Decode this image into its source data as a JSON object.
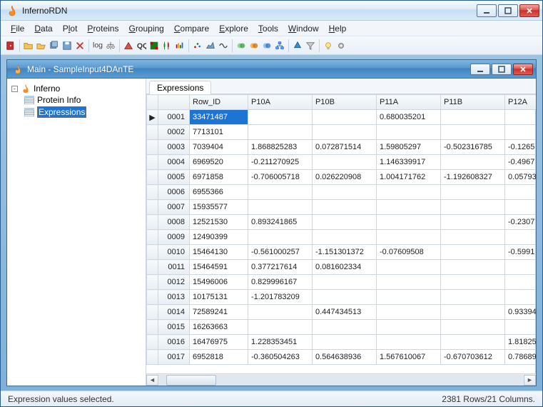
{
  "app_title": "InfernoRDN",
  "menu": [
    "File",
    "Data",
    "Plot",
    "Proteins",
    "Grouping",
    "Compare",
    "Explore",
    "Tools",
    "Window",
    "Help"
  ],
  "child_title": "Main - SampleInput4DAnTE",
  "tree": {
    "root": "Inferno",
    "children": [
      "Protein Info",
      "Expressions"
    ],
    "selected": 1
  },
  "tab_label": "Expressions",
  "columns": [
    "Row_ID",
    "P10A",
    "P10B",
    "P11A",
    "P11B",
    "P12A"
  ],
  "rows": [
    {
      "n": "0001",
      "marker": "▶",
      "cells": [
        "33471487",
        "",
        "",
        "0.680035201",
        "",
        ""
      ],
      "sel": 0
    },
    {
      "n": "0002",
      "cells": [
        "7713101",
        "",
        "",
        "",
        "",
        ""
      ]
    },
    {
      "n": "0003",
      "cells": [
        "7039404",
        "1.868825283",
        "0.072871514",
        "1.59805297",
        "-0.502316785",
        "-0.1265"
      ]
    },
    {
      "n": "0004",
      "cells": [
        "6969520",
        "-0.211270925",
        "",
        "1.146339917",
        "",
        "-0.4967"
      ]
    },
    {
      "n": "0005",
      "cells": [
        "6971858",
        "-0.706005718",
        "0.026220908",
        "1.004171762",
        "-1.192608327",
        "0.05793"
      ]
    },
    {
      "n": "0006",
      "cells": [
        "6955366",
        "",
        "",
        "",
        "",
        ""
      ]
    },
    {
      "n": "0007",
      "cells": [
        "15935577",
        "",
        "",
        "",
        "",
        ""
      ]
    },
    {
      "n": "0008",
      "cells": [
        "12521530",
        "0.893241865",
        "",
        "",
        "",
        "-0.2307"
      ]
    },
    {
      "n": "0009",
      "cells": [
        "12490399",
        "",
        "",
        "",
        "",
        ""
      ]
    },
    {
      "n": "0010",
      "cells": [
        "15464130",
        "-0.561000257",
        "-1.151301372",
        "-0.07609508",
        "",
        "-0.5991"
      ]
    },
    {
      "n": "0011",
      "cells": [
        "15464591",
        "0.377217614",
        "0.081602334",
        "",
        "",
        ""
      ]
    },
    {
      "n": "0012",
      "cells": [
        "15496006",
        "0.829996167",
        "",
        "",
        "",
        ""
      ]
    },
    {
      "n": "0013",
      "cells": [
        "10175131",
        "-1.201783209",
        "",
        "",
        "",
        ""
      ]
    },
    {
      "n": "0014",
      "cells": [
        "72589241",
        "",
        "0.447434513",
        "",
        "",
        "0.93394"
      ]
    },
    {
      "n": "0015",
      "cells": [
        "16263663",
        "",
        "",
        "",
        "",
        ""
      ]
    },
    {
      "n": "0016",
      "cells": [
        "16476975",
        "1.228353451",
        "",
        "",
        "",
        "1.81825"
      ]
    },
    {
      "n": "0017",
      "cells": [
        "6952818",
        "-0.360504263",
        "0.564638936",
        "1.567610067",
        "-0.670703612",
        "0.78689"
      ]
    }
  ],
  "status_left": "Expression values selected.",
  "status_right": "2381 Rows/21 Columns.",
  "toolbar_icons": [
    "open-door",
    "sep",
    "folder",
    "folder-open",
    "disks",
    "disk",
    "x-red",
    "sep",
    "log2",
    "scale",
    "sep",
    "triangle",
    "qq",
    "heatmap-green",
    "candlestick",
    "spectrum",
    "sep",
    "scatter",
    "area",
    "wave",
    "sep",
    "venn-green",
    "venn-orange",
    "venn-blue",
    "hierarchy",
    "sep",
    "tree-blue",
    "funnel",
    "sep",
    "bulb",
    "gear"
  ]
}
